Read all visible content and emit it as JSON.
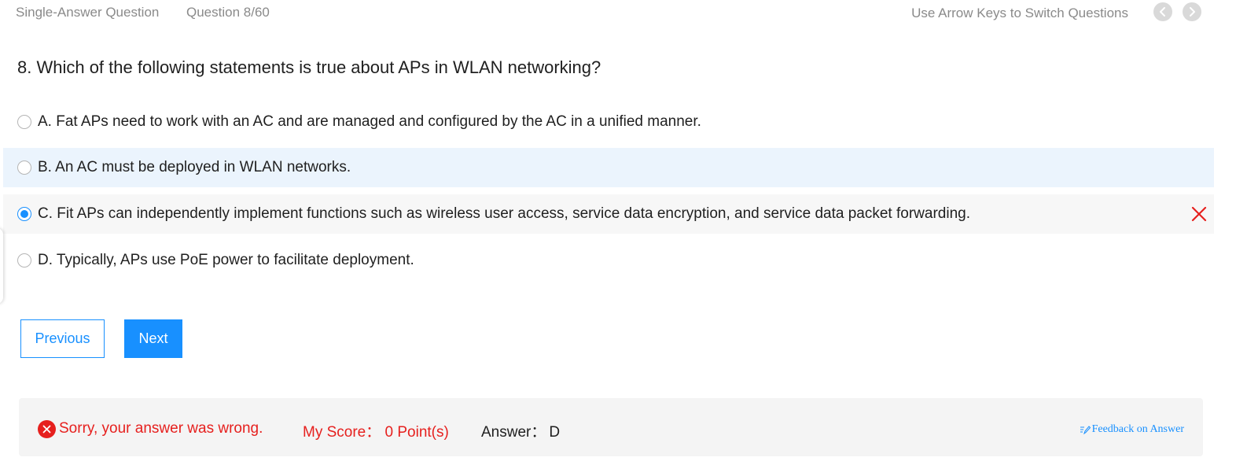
{
  "header": {
    "question_type": "Single-Answer Question",
    "question_counter": "Question 8/60",
    "switch_hint": "Use Arrow Keys to Switch Questions",
    "prev_icon": "chevron-left-icon",
    "next_icon": "chevron-right-icon"
  },
  "question": {
    "text": "8. Which of the following statements is true about APs in WLAN networking?"
  },
  "options": [
    {
      "label": "A. Fat APs need to work with an AC and are managed and configured by the AC in a unified manner.",
      "selected": false
    },
    {
      "label": "B. An AC must be deployed in WLAN networks.",
      "selected": false
    },
    {
      "label": "C. Fit APs can independently implement functions such as wireless user access, service data encryption, and service data packet forwarding.",
      "selected": true,
      "marked": "wrong"
    },
    {
      "label": "D. Typically, APs use PoE power to facilitate deployment.",
      "selected": false
    }
  ],
  "buttons": {
    "previous": "Previous",
    "next": "Next"
  },
  "result": {
    "status_text": "Sorry, your answer was wrong.",
    "score_text": "My Score： 0 Point(s)",
    "answer_label": "Answer：",
    "answer_value": "D",
    "feedback_link": "Feedback on Answer"
  },
  "colors": {
    "accent": "#1890ff",
    "error": "#e6201e",
    "hover_row": "#ebf4fd",
    "selected_row": "#f7f7f7",
    "result_bg": "#f4f4f4"
  }
}
